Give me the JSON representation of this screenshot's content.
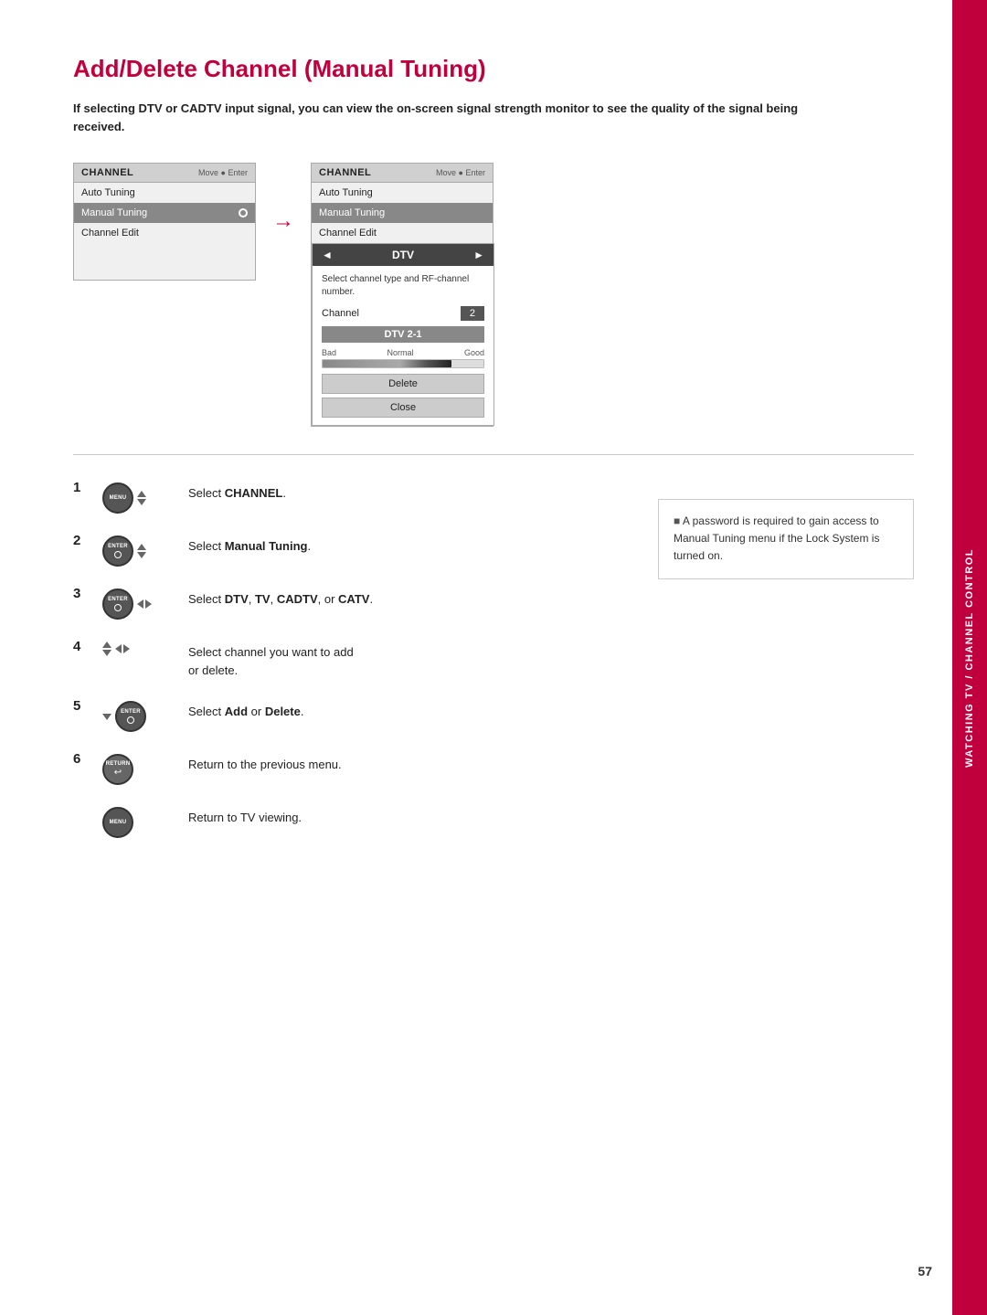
{
  "page": {
    "title": "Add/Delete Channel (Manual Tuning)",
    "page_number": "57"
  },
  "sidebar": {
    "label": "WATCHING TV / CHANNEL CONTROL"
  },
  "intro": {
    "text": "If selecting DTV or CADTV input signal, you can view the on-screen signal strength monitor to see the quality of the signal being received."
  },
  "panel_left": {
    "header": "CHANNEL",
    "header_hint": "Move  ● Enter",
    "items": [
      {
        "label": "Auto Tuning",
        "highlighted": false
      },
      {
        "label": "Manual Tuning",
        "highlighted": true
      },
      {
        "label": "Channel Edit",
        "highlighted": false
      }
    ]
  },
  "panel_right": {
    "header": "CHANNEL",
    "header_hint": "Move  ● Enter",
    "items": [
      {
        "label": "Auto Tuning",
        "highlighted": false
      },
      {
        "label": "Manual Tuning",
        "highlighted": true
      },
      {
        "label": "Channel Edit",
        "highlighted": false
      }
    ],
    "submenu": {
      "title": "DTV",
      "description": "Select channel type and RF-channel number.",
      "channel_label": "Channel",
      "channel_number": "2",
      "channel_name": "DTV 2-1",
      "signal_labels": {
        "bad": "Bad",
        "normal": "Normal",
        "good": "Good"
      },
      "buttons": [
        "Delete",
        "Close"
      ]
    }
  },
  "arrow": "→",
  "steps": [
    {
      "number": "1",
      "icons": [
        "menu-btn",
        "ud-arrows"
      ],
      "text": "Select ",
      "bold_text": "CHANNEL",
      "text_after": "."
    },
    {
      "number": "2",
      "icons": [
        "enter-btn",
        "ud-arrows"
      ],
      "text": "Select ",
      "bold_text": "Manual Tuning",
      "text_after": "."
    },
    {
      "number": "3",
      "icons": [
        "enter-btn",
        "lr-arrows"
      ],
      "text": "Select ",
      "bold_text": "DTV",
      "text_mid": ", ",
      "bold_text2": "TV",
      "text_mid2": ", ",
      "bold_text3": "CADTV",
      "text_mid3": ", or ",
      "bold_text4": "CATV",
      "text_after": "."
    },
    {
      "number": "4",
      "icons": [
        "ud-arrows",
        "lr-arrows"
      ],
      "text": "Select channel you want to add or delete."
    },
    {
      "number": "5",
      "icons": [
        "down-arrow-btn",
        "enter-btn"
      ],
      "text": "Select ",
      "bold_text": "Add",
      "text_mid": " or ",
      "bold_text2": "Delete",
      "text_after": "."
    },
    {
      "number": "6",
      "icons": [
        "return-btn"
      ],
      "text": "Return to the previous menu."
    },
    {
      "number": "",
      "icons": [
        "menu-btn2"
      ],
      "text": "Return to TV viewing."
    }
  ],
  "note": {
    "text": "A password is required to gain access to Manual Tuning menu if the Lock System is turned on."
  }
}
